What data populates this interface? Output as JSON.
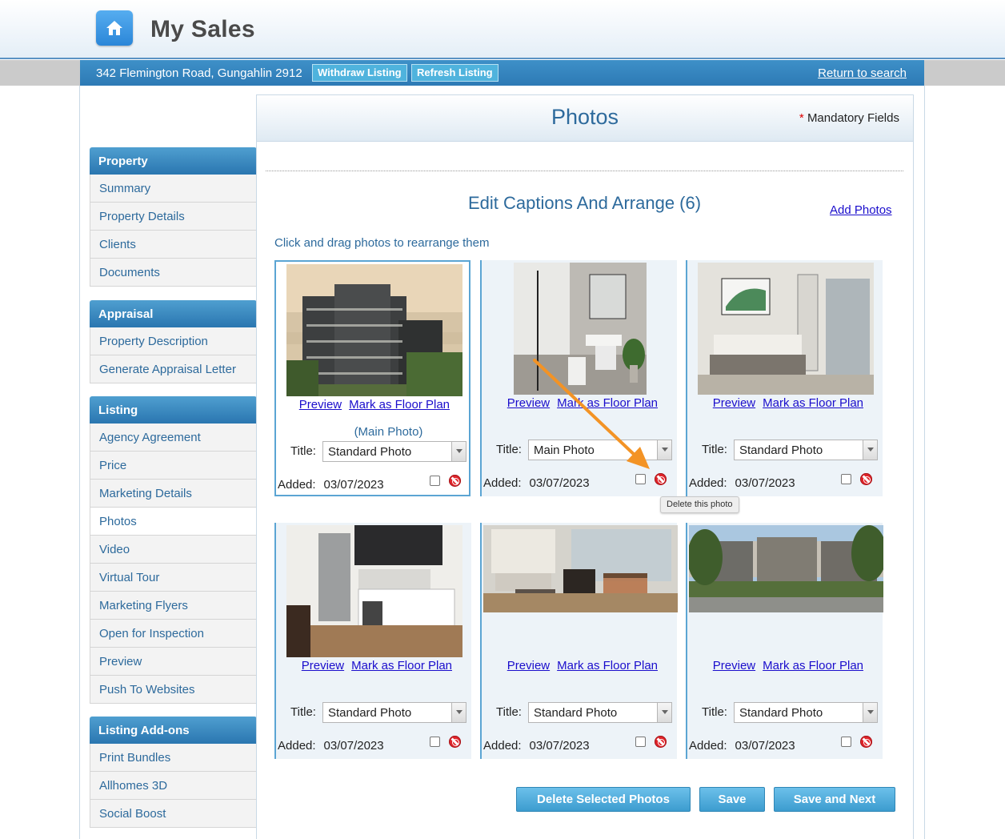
{
  "header": {
    "app_title": "My Sales"
  },
  "address_bar": {
    "address": "342 Flemington Road, Gungahlin 2912",
    "withdraw_label": "Withdraw Listing",
    "refresh_label": "Refresh Listing",
    "return_label": "Return to search"
  },
  "sidebar": {
    "sections": [
      {
        "title": "Property",
        "items": [
          "Summary",
          "Property Details",
          "Clients",
          "Documents"
        ]
      },
      {
        "title": "Appraisal",
        "items": [
          "Property Description",
          "Generate Appraisal Letter"
        ]
      },
      {
        "title": "Listing",
        "items": [
          "Agency Agreement",
          "Price",
          "Marketing Details",
          "Photos",
          "Video",
          "Virtual Tour",
          "Marketing Flyers",
          "Open for Inspection",
          "Preview",
          "Push To Websites"
        ]
      },
      {
        "title": "Listing Add-ons",
        "items": [
          "Print Bundles",
          "Allhomes 3D",
          "Social Boost"
        ]
      }
    ],
    "active_item": "Photos"
  },
  "main": {
    "title": "Photos",
    "mandatory_star": "*",
    "mandatory_label": "Mandatory Fields",
    "section_title": "Edit Captions And Arrange (6)",
    "add_photos_label": "Add Photos",
    "instructions": "Click and drag photos to rearrange them"
  },
  "photo_labels": {
    "preview": "Preview",
    "floor_plan": "Mark as Floor Plan",
    "title_label": "Title:",
    "added_label": "Added:",
    "main_note": "(Main Photo)"
  },
  "photos": [
    {
      "scene": "apartment-exterior-aerial",
      "title": "Standard Photo",
      "added": "03/07/2023",
      "is_main": true
    },
    {
      "scene": "bathroom",
      "title": "Main Photo",
      "added": "03/07/2023",
      "is_main": false
    },
    {
      "scene": "bedroom",
      "title": "Standard Photo",
      "added": "03/07/2023",
      "is_main": false
    },
    {
      "scene": "kitchen",
      "title": "Standard Photo",
      "added": "03/07/2023",
      "is_main": false
    },
    {
      "scene": "living-room",
      "title": "Standard Photo",
      "added": "03/07/2023",
      "is_main": false
    },
    {
      "scene": "apartment-exterior-street",
      "title": "Standard Photo",
      "added": "03/07/2023",
      "is_main": false
    }
  ],
  "tooltip": "Delete this photo",
  "buttons": {
    "delete_selected": "Delete Selected Photos",
    "save": "Save",
    "save_next": "Save and Next"
  },
  "colors": {
    "accent": "#2d6a9c",
    "header_bar": "#2d7ab5",
    "button": "#4fb0de",
    "annotation_arrow": "#f39325",
    "delete_red": "#e0242a"
  }
}
